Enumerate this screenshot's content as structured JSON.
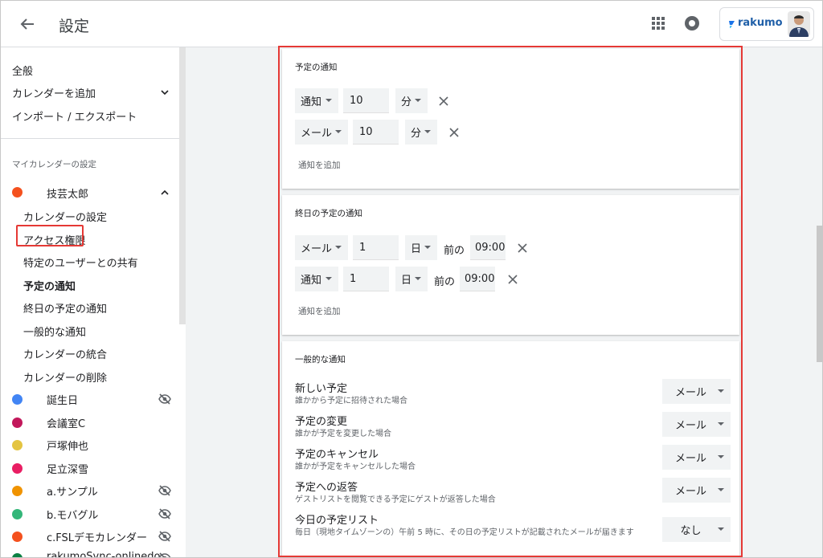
{
  "header": {
    "title": "設定",
    "brand": "rakumo"
  },
  "sidebar": {
    "top_items": [
      "全般",
      "カレンダーを追加",
      "インポート / エクスポート"
    ],
    "section_title": "マイカレンダーの設定",
    "owner": {
      "name": "技芸太郎",
      "color": "#f4511e"
    },
    "owner_items": [
      "カレンダーの設定",
      "アクセス権限",
      "特定のユーザーとの共有",
      "予定の通知",
      "終日の予定の通知",
      "一般的な通知",
      "カレンダーの統合",
      "カレンダーの削除"
    ],
    "active_item": "予定の通知",
    "calendars": [
      {
        "name": "誕生日",
        "color": "#4285f4",
        "hidden": true
      },
      {
        "name": "会議室C",
        "color": "#c2185b",
        "hidden": false
      },
      {
        "name": "戸塚伸也",
        "color": "#e4c441",
        "hidden": false
      },
      {
        "name": "足立深雪",
        "color": "#e91e63",
        "hidden": false
      },
      {
        "name": "a.サンプル",
        "color": "#f09300",
        "hidden": true
      },
      {
        "name": "b.モバグル",
        "color": "#33b679",
        "hidden": true
      },
      {
        "name": "c.FSLデモカレンダー",
        "color": "#f4511e",
        "hidden": true
      },
      {
        "name": "rakumoSync-onlinedo",
        "color": "#0b8043",
        "hidden": true
      }
    ]
  },
  "event_notifications": {
    "title": "予定の通知",
    "rows": [
      {
        "method": "通知",
        "value": "10",
        "unit": "分"
      },
      {
        "method": "メール",
        "value": "10",
        "unit": "分"
      }
    ],
    "add_label": "通知を追加"
  },
  "allday_notifications": {
    "title": "終日の予定の通知",
    "rows": [
      {
        "method": "メール",
        "value": "1",
        "unit": "日",
        "before": "前の",
        "time": "09:00"
      },
      {
        "method": "通知",
        "value": "1",
        "unit": "日",
        "before": "前の",
        "time": "09:00"
      }
    ],
    "add_label": "通知を追加"
  },
  "general_notifications": {
    "title": "一般的な通知",
    "items": [
      {
        "title": "新しい予定",
        "desc": "誰かから予定に招待された場合",
        "value": "メール"
      },
      {
        "title": "予定の変更",
        "desc": "誰かが予定を変更した場合",
        "value": "メール"
      },
      {
        "title": "予定のキャンセル",
        "desc": "誰かが予定をキャンセルした場合",
        "value": "メール"
      },
      {
        "title": "予定への返答",
        "desc": "ゲストリストを閲覧できる予定にゲストが返答した場合",
        "value": "メール"
      },
      {
        "title": "今日の予定リスト",
        "desc": "毎日（現地タイムゾーンの）午前 5 時に、その日の予定リストが記載されたメールが届きます",
        "value": "なし"
      }
    ]
  },
  "colors": {
    "highlight": "#e53935",
    "background": "#f1f3f4"
  }
}
